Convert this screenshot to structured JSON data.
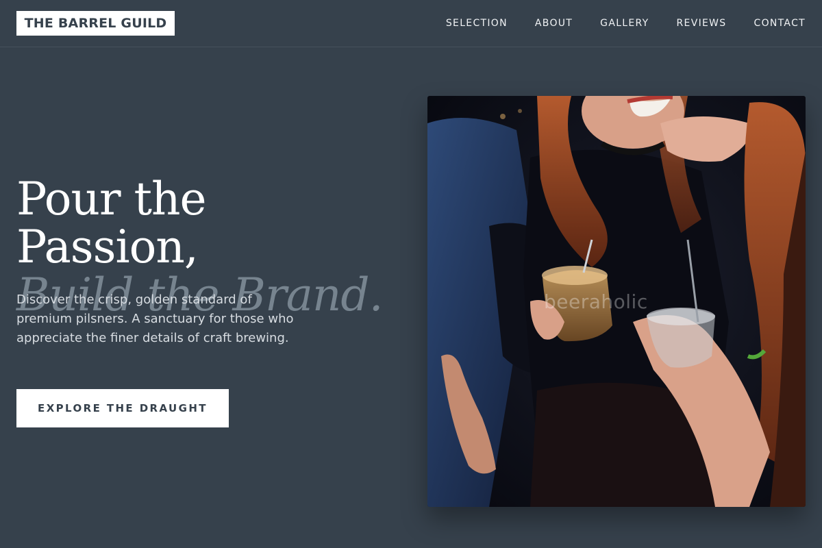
{
  "brand": {
    "name": "THE BARREL GUILD"
  },
  "nav": {
    "items": [
      {
        "label": "SELECTION"
      },
      {
        "label": "ABOUT"
      },
      {
        "label": "GALLERY"
      },
      {
        "label": "REVIEWS"
      },
      {
        "label": "CONTACT"
      }
    ]
  },
  "hero": {
    "title_line1": "Pour the Passion,",
    "title_line2": "Build the Brand.",
    "description": "Discover the crisp, golden standard of premium pilsners. A sanctuary for those who appreciate the finer details of craft brewing.",
    "cta_label": "EXPLORE THE DRAUGHT",
    "image": {
      "alt": "friends toasting cocktails",
      "watermark": "beeraholic"
    }
  },
  "colors": {
    "background": "#36414c",
    "accent_muted": "#77848f",
    "button_bg": "#ffffff",
    "button_text": "#36414c"
  }
}
